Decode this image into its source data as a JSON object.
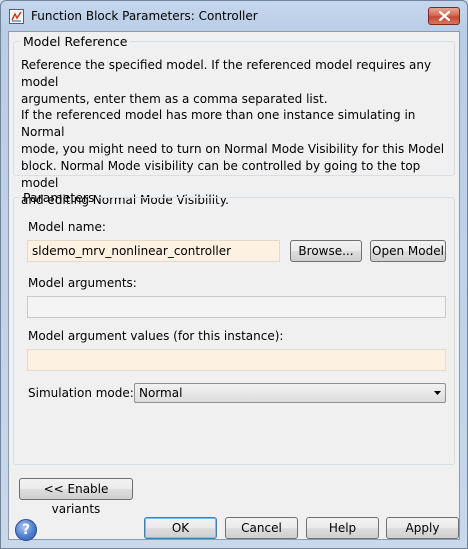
{
  "window": {
    "title": "Function Block Parameters: Controller",
    "icon": "simulink-block-icon",
    "close_icon": "close-icon"
  },
  "model_reference": {
    "legend": "Model Reference",
    "paragraph1_lines": [
      "Reference the specified model. If the referenced model requires any model",
      "arguments, enter them as a comma separated list."
    ],
    "paragraph2_lines": [
      "If the referenced model has more than one instance simulating in Normal",
      "mode, you might need to turn on Normal Mode Visibility for this Model",
      "block. Normal Mode visibility can be controlled by going to the top model",
      "and editing Normal Mode Visibility."
    ]
  },
  "parameters": {
    "legend": "Parameters",
    "model_name_label": "Model name:",
    "model_name_value": "sldemo_mrv_nonlinear_controller",
    "browse_label": "Browse...",
    "open_model_label": "Open Model",
    "model_arguments_label": "Model arguments:",
    "model_arguments_value": "",
    "arg_values_label": "Model argument values (for this instance):",
    "arg_values_value": "",
    "sim_mode_label": "Simulation mode:",
    "sim_mode_value": "Normal"
  },
  "variants_button_label": "<< Enable variants",
  "footer": {
    "help_icon": "help-icon",
    "help_glyph": "?",
    "ok_label": "OK",
    "cancel_label": "Cancel",
    "help_label": "Help",
    "apply_label": "Apply"
  },
  "colors": {
    "editable_field_bg": "#fdf1e1",
    "default_button_border": "#3c7fb1",
    "close_button": "#c44a33"
  }
}
